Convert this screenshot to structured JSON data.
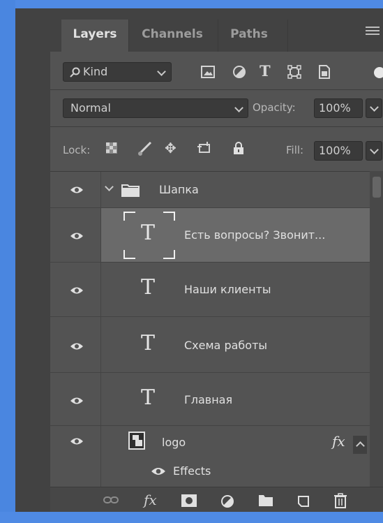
{
  "tabs": [
    {
      "label": "Layers",
      "active": true
    },
    {
      "label": "Channels",
      "active": false
    },
    {
      "label": "Paths",
      "active": false
    }
  ],
  "filter": {
    "kind_label": "Kind",
    "icons": [
      "image-filter-icon",
      "adjustment-filter-icon",
      "type-filter-icon",
      "shape-filter-icon",
      "smart-object-filter-icon"
    ]
  },
  "blend": {
    "mode": "Normal",
    "opacity_label": "Opacity:",
    "opacity_value": "100%"
  },
  "lock": {
    "label": "Lock:",
    "fill_label": "Fill:",
    "fill_value": "100%"
  },
  "layers": {
    "group": {
      "name": "Шапка"
    },
    "items": [
      {
        "name": "Есть вопросы? Звонит...",
        "type": "text",
        "selected": true
      },
      {
        "name": "Наши клиенты",
        "type": "text",
        "selected": false
      },
      {
        "name": "Схема работы",
        "type": "text",
        "selected": false
      },
      {
        "name": "Главная",
        "type": "text",
        "selected": false
      }
    ],
    "logo": {
      "name": "logo",
      "fx": "fx",
      "effects_label": "Effects"
    }
  },
  "bottom_icons": [
    "link-layers-icon",
    "fx-icon",
    "mask-icon",
    "adjustment-layer-icon",
    "new-group-icon",
    "new-layer-icon",
    "trash-icon"
  ],
  "colors": {
    "panel_bg": "#535353",
    "selected_row": "#6a6a6a",
    "frame_blue": "#4a86e0"
  }
}
